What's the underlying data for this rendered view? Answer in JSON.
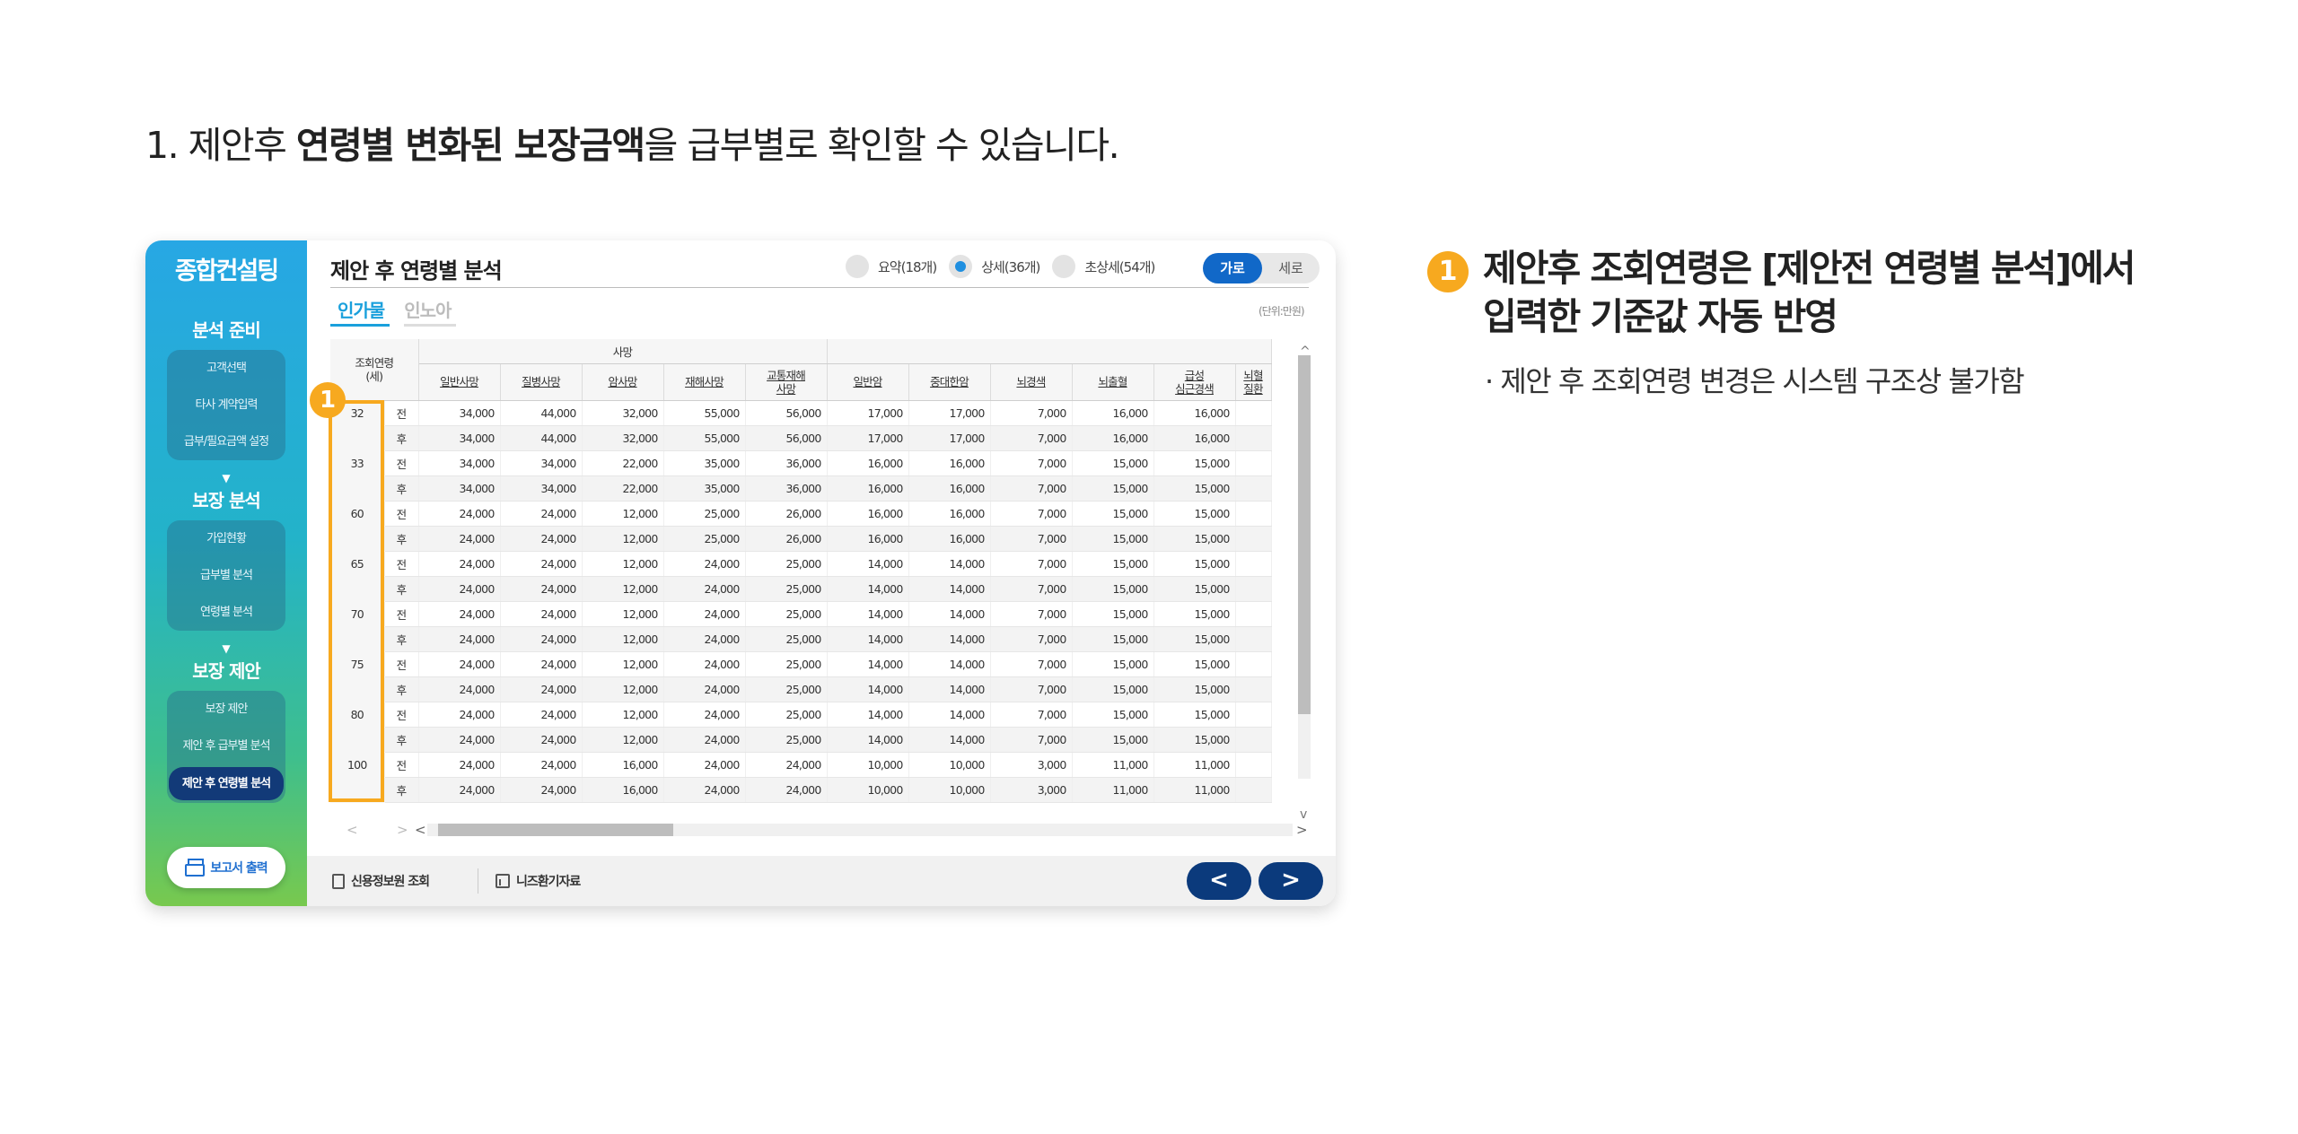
{
  "heading": {
    "prefix": "1. 제안후 ",
    "bold": "연령별 변화된 보장금액",
    "suffix": "을 급부별로 확인할 수 있습니다."
  },
  "sidebar": {
    "title": "종합컨설팅",
    "sections": [
      {
        "label": "분석 준비",
        "items": [
          "고객선택",
          "타사 계약입력",
          "급부/필요금액 설정"
        ]
      },
      {
        "label": "보장 분석",
        "items": [
          "가입현황",
          "급부별 분석",
          "연령별 분석"
        ]
      },
      {
        "label": "보장 제안",
        "items": [
          "보장 제안",
          "제안 후 급부별 분석",
          "제안 후 연령별 분석"
        ]
      }
    ],
    "active_item": "제안 후 연령별 분석",
    "report_button": "보고서 출력"
  },
  "main": {
    "title": "제안 후 연령별 분석",
    "radio_options": [
      "요약(18개)",
      "상세(36개)",
      "초상세(54개)"
    ],
    "radio_selected": "상세(36개)",
    "orientation": {
      "horizontal": "가로",
      "vertical": "세로",
      "selected": "가로"
    },
    "tabs": [
      "인가물",
      "인노아"
    ],
    "active_tab": "인가물",
    "unit": "(단위:만원)"
  },
  "table": {
    "age_header": "조회연령\n(세)",
    "group_header": "사망",
    "columns": [
      "일반사망",
      "질병사망",
      "암사망",
      "재해사망",
      "교통재해\n사망",
      "일반암",
      "중대한암",
      "뇌경색",
      "뇌출혈",
      "급성\n심근경색",
      "뇌혈\n질환"
    ],
    "rows": [
      {
        "age": "32",
        "ba": "전",
        "values": [
          "34,000",
          "44,000",
          "32,000",
          "55,000",
          "56,000",
          "17,000",
          "17,000",
          "7,000",
          "16,000",
          "16,000"
        ]
      },
      {
        "age": "",
        "ba": "후",
        "values": [
          "34,000",
          "44,000",
          "32,000",
          "55,000",
          "56,000",
          "17,000",
          "17,000",
          "7,000",
          "16,000",
          "16,000"
        ]
      },
      {
        "age": "33",
        "ba": "전",
        "values": [
          "34,000",
          "34,000",
          "22,000",
          "35,000",
          "36,000",
          "16,000",
          "16,000",
          "7,000",
          "15,000",
          "15,000"
        ]
      },
      {
        "age": "",
        "ba": "후",
        "values": [
          "34,000",
          "34,000",
          "22,000",
          "35,000",
          "36,000",
          "16,000",
          "16,000",
          "7,000",
          "15,000",
          "15,000"
        ]
      },
      {
        "age": "60",
        "ba": "전",
        "values": [
          "24,000",
          "24,000",
          "12,000",
          "25,000",
          "26,000",
          "16,000",
          "16,000",
          "7,000",
          "15,000",
          "15,000"
        ]
      },
      {
        "age": "",
        "ba": "후",
        "values": [
          "24,000",
          "24,000",
          "12,000",
          "25,000",
          "26,000",
          "16,000",
          "16,000",
          "7,000",
          "15,000",
          "15,000"
        ]
      },
      {
        "age": "65",
        "ba": "전",
        "values": [
          "24,000",
          "24,000",
          "12,000",
          "24,000",
          "25,000",
          "14,000",
          "14,000",
          "7,000",
          "15,000",
          "15,000"
        ]
      },
      {
        "age": "",
        "ba": "후",
        "values": [
          "24,000",
          "24,000",
          "12,000",
          "24,000",
          "25,000",
          "14,000",
          "14,000",
          "7,000",
          "15,000",
          "15,000"
        ]
      },
      {
        "age": "70",
        "ba": "전",
        "values": [
          "24,000",
          "24,000",
          "12,000",
          "24,000",
          "25,000",
          "14,000",
          "14,000",
          "7,000",
          "15,000",
          "15,000"
        ]
      },
      {
        "age": "",
        "ba": "후",
        "values": [
          "24,000",
          "24,000",
          "12,000",
          "24,000",
          "25,000",
          "14,000",
          "14,000",
          "7,000",
          "15,000",
          "15,000"
        ]
      },
      {
        "age": "75",
        "ba": "전",
        "values": [
          "24,000",
          "24,000",
          "12,000",
          "24,000",
          "25,000",
          "14,000",
          "14,000",
          "7,000",
          "15,000",
          "15,000"
        ]
      },
      {
        "age": "",
        "ba": "후",
        "values": [
          "24,000",
          "24,000",
          "12,000",
          "24,000",
          "25,000",
          "14,000",
          "14,000",
          "7,000",
          "15,000",
          "15,000"
        ]
      },
      {
        "age": "80",
        "ba": "전",
        "values": [
          "24,000",
          "24,000",
          "12,000",
          "24,000",
          "25,000",
          "14,000",
          "14,000",
          "7,000",
          "15,000",
          "15,000"
        ]
      },
      {
        "age": "",
        "ba": "후",
        "values": [
          "24,000",
          "24,000",
          "12,000",
          "24,000",
          "25,000",
          "14,000",
          "14,000",
          "7,000",
          "15,000",
          "15,000"
        ]
      },
      {
        "age": "100",
        "ba": "전",
        "values": [
          "24,000",
          "24,000",
          "16,000",
          "24,000",
          "24,000",
          "10,000",
          "10,000",
          "3,000",
          "11,000",
          "11,000"
        ]
      },
      {
        "age": "",
        "ba": "후",
        "values": [
          "24,000",
          "24,000",
          "16,000",
          "24,000",
          "24,000",
          "10,000",
          "10,000",
          "3,000",
          "11,000",
          "11,000"
        ]
      }
    ]
  },
  "footer": {
    "credit_link": "신용정보원 조회",
    "needs_link": "니즈환기자료",
    "prev_symbol": "<",
    "next_symbol": ">"
  },
  "scroll_symbols": {
    "up": "^",
    "down": "v",
    "left": "<",
    "right": ">"
  },
  "badge": "1",
  "right": {
    "title": "제안후 조회연령은 [제안전 연령별 분석]에서\n입력한 기준값 자동 반영",
    "note": "· 제안 후 조회연령 변경은 시스템 구조상 불가함"
  },
  "colors": {
    "accent": "#f7a91f",
    "navy": "#0b3a7c",
    "tab_blue": "#1aa0dc"
  }
}
